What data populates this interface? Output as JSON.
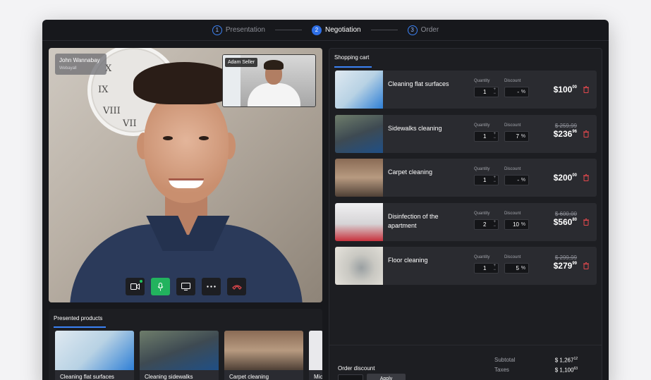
{
  "stepper": {
    "steps": [
      {
        "num": "1",
        "label": "Presentation"
      },
      {
        "num": "2",
        "label": "Negotiation"
      },
      {
        "num": "3",
        "label": "Order"
      }
    ],
    "active_step": 2
  },
  "video": {
    "main_name": "John Wannabay",
    "main_role": "Webayall",
    "pip_name": "Adam Seller",
    "controls": [
      "camera-icon",
      "microphone-icon",
      "screen-share-icon",
      "more-icon",
      "hang-up-icon"
    ]
  },
  "presented": {
    "title": "Presented products",
    "items": [
      {
        "label": "Cleaning flat surfaces"
      },
      {
        "label": "Cleaning sidewalks"
      },
      {
        "label": "Carpet cleaning"
      },
      {
        "label": "Mic"
      }
    ]
  },
  "cart": {
    "title": "Shopping cart",
    "qty_label": "Quantity",
    "disc_label": "Discount",
    "items": [
      {
        "name": "Cleaning flat surfaces",
        "qty": "1",
        "discount": "-",
        "old_price": "",
        "price": "$100",
        "cents": "00"
      },
      {
        "name": "Sidewalks cleaning",
        "qty": "1",
        "discount": "7",
        "old_price": "$ 259,99",
        "price": "$236",
        "cents": "96"
      },
      {
        "name": "Carpet cleaning",
        "qty": "1",
        "discount": "-",
        "old_price": "",
        "price": "$200",
        "cents": "00"
      },
      {
        "name": "Disinfection of the apartment",
        "qty": "2",
        "discount": "10",
        "old_price": "$ 600,00",
        "price": "$560",
        "cents": "80"
      },
      {
        "name": "Floor cleaning",
        "qty": "1",
        "discount": "5",
        "old_price": "$ 299,99",
        "price": "$279",
        "cents": "99"
      }
    ],
    "order_discount_label": "Order discount",
    "apply_label": "Apply",
    "subtotal_label": "Subtotal",
    "subtotal_value": "$ 1,267",
    "subtotal_cents": "12",
    "taxes_label": "Taxes",
    "taxes_value": "$ 1,100",
    "taxes_cents": "63",
    "colors": {
      "accent": "#3b82f6",
      "trash": "#e5484d",
      "mic": "#22b35e"
    }
  }
}
